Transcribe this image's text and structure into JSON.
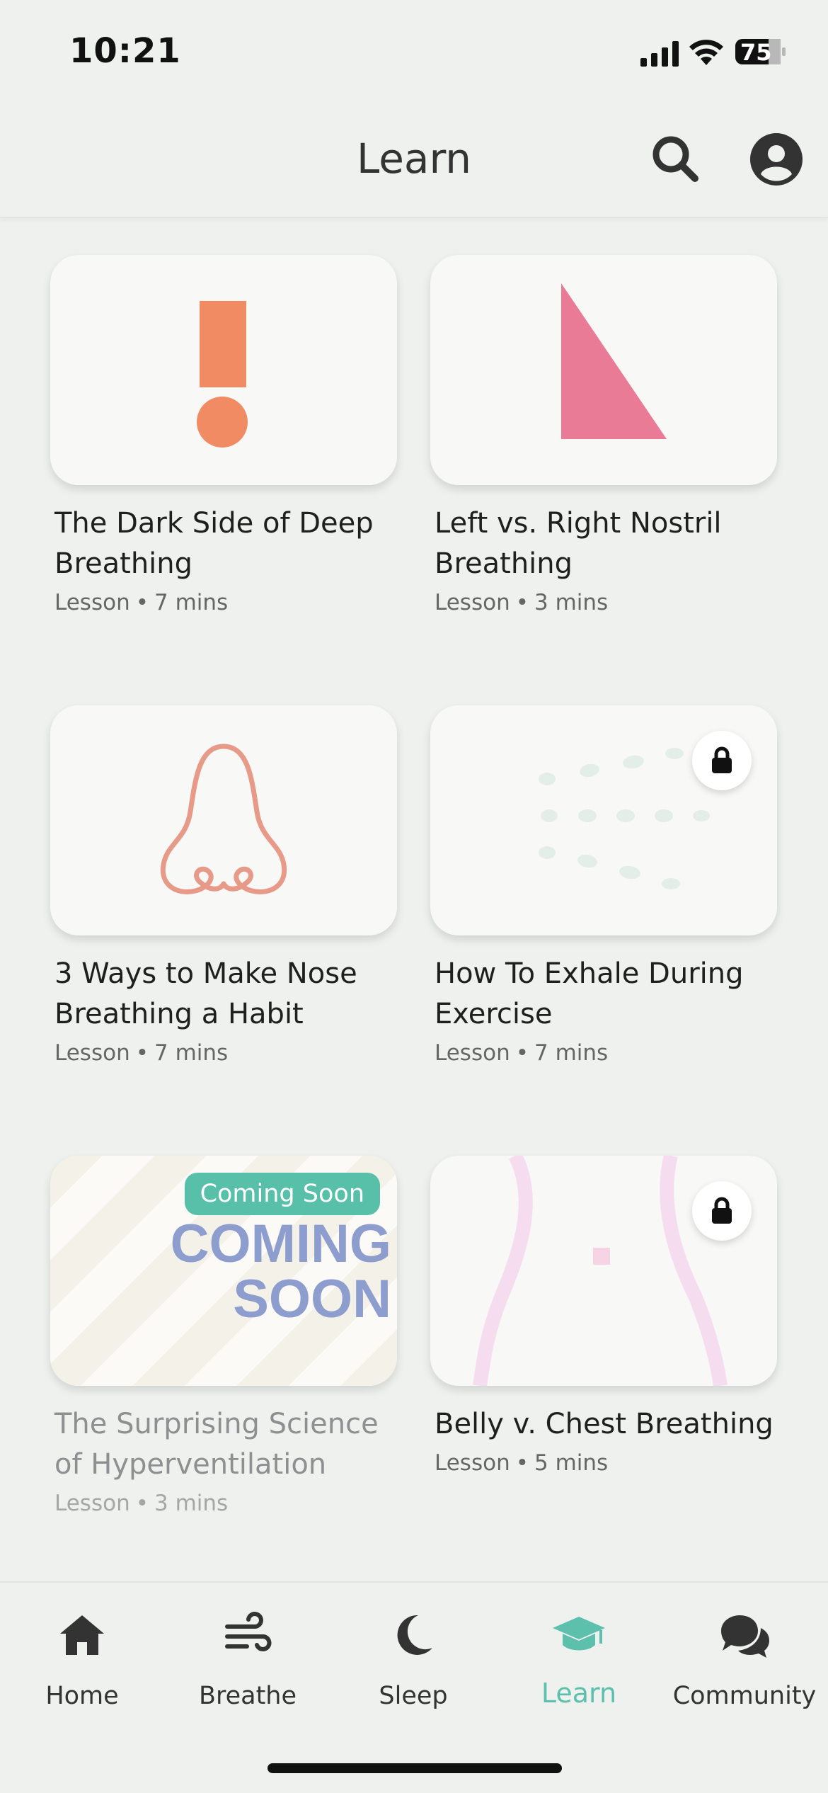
{
  "status_bar": {
    "time": "10:21",
    "battery": "75"
  },
  "header": {
    "title": "Learn"
  },
  "cards": [
    {
      "title": "The Dark Side of Deep Breathing",
      "type": "Lesson",
      "duration": "7 mins"
    },
    {
      "title": "Left vs. Right Nostril Breathing",
      "type": "Lesson",
      "duration": "3 mins"
    },
    {
      "title": "3 Ways to Make Nose Breathing a Habit",
      "type": "Lesson",
      "duration": "7 mins"
    },
    {
      "title": "How To Exhale During Exercise",
      "type": "Lesson",
      "duration": "7 mins",
      "locked": true
    },
    {
      "title": "The Surprising Science of Hyperventilation",
      "type": "Lesson",
      "duration": "3 mins",
      "badge": "Coming Soon",
      "thumb_text_1": "COMING",
      "thumb_text_2": "SOON"
    },
    {
      "title": "Belly v. Chest Breathing",
      "type": "Lesson",
      "duration": "5 mins",
      "locked": true
    }
  ],
  "meta_separator": "•",
  "nav": {
    "items": [
      {
        "label": "Home",
        "icon": "house-icon"
      },
      {
        "label": "Breathe",
        "icon": "wind-icon"
      },
      {
        "label": "Sleep",
        "icon": "moon-icon"
      },
      {
        "label": "Learn",
        "icon": "graduation-cap-icon",
        "active": true
      },
      {
        "label": "Community",
        "icon": "chat-bubbles-icon"
      }
    ]
  },
  "colors": {
    "accent": "#5cc0ad",
    "orange": "#f08b64",
    "pink": "#e97b97",
    "coming_soon": "#8c9dce"
  }
}
